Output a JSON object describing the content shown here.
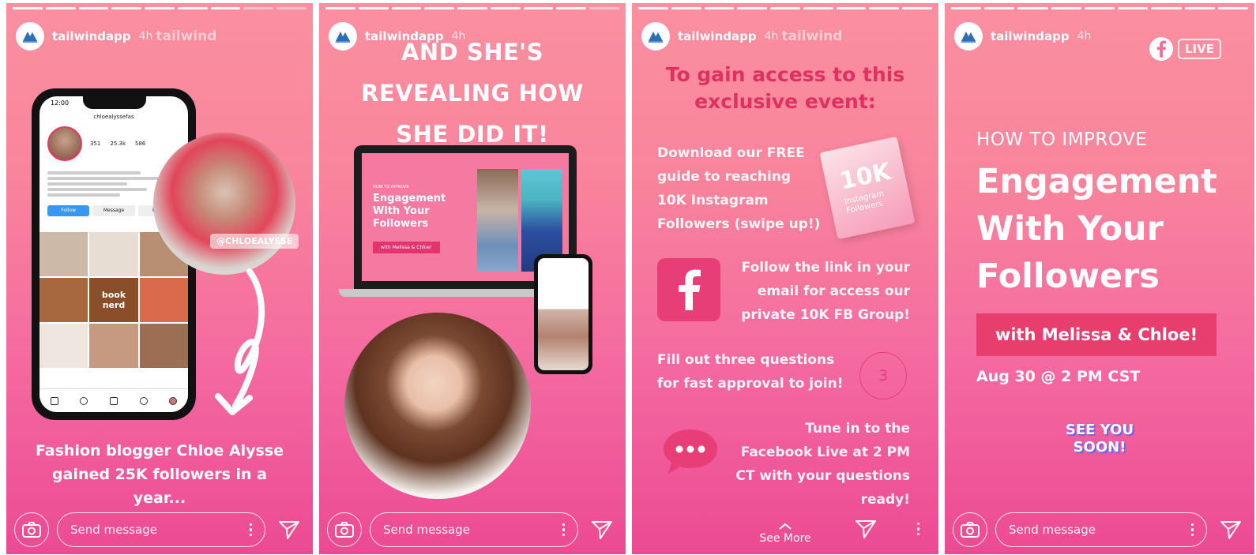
{
  "stories": [
    {
      "user": "tailwindapp",
      "time": "4h",
      "watermark": "tailwind",
      "caption": "Fashion blogger Chloe Alysse gained 25K followers in a year...",
      "sticker_tag": "@CHLOEALYSSE",
      "phone": {
        "status_time": "12:00",
        "handle": "chloealyssefas",
        "stats": [
          "351",
          "25.3k",
          "586"
        ],
        "buttons": [
          "Follow",
          "Message",
          "Email"
        ],
        "grid_label": "book nerd"
      },
      "message_placeholder": "Send message"
    },
    {
      "user": "tailwindapp",
      "time": "4h",
      "title": "AND SHE'S REVEALING HOW SHE DID IT!",
      "laptop": {
        "kicker": "HOW TO IMPROVE",
        "title": "Engagement With Your Followers",
        "pill": "with Melissa & Chloe!"
      },
      "message_placeholder": "Send message"
    },
    {
      "user": "tailwindapp",
      "time": "4h",
      "watermark": "tailwind",
      "title": "To gain access to this exclusive event:",
      "step1": "Download our FREE guide to reaching 10K Instagram Followers (swipe up!)",
      "ebook": {
        "big": "10K",
        "sub": "Instagram Followers"
      },
      "step2": "Follow the link in your email for access our private 10K FB Group!",
      "step3": "Fill out three questions for fast approval to join!",
      "step3_number": "3",
      "step4": "Tune in to the Facebook Live at 2 PM CT with your questions ready!",
      "see_more": "See More"
    },
    {
      "user": "tailwindapp",
      "time": "4h",
      "live_label": "LIVE",
      "kicker": "HOW TO IMPROVE",
      "title": "Engagement With Your Followers",
      "pill": "with Melissa & Chloe!",
      "date": "Aug 30 @ 2 PM CST",
      "sticker": "SEE YOU SOON!",
      "message_placeholder": "Send message"
    }
  ],
  "colors": {
    "gradient_top": "#fb8fa0",
    "gradient_bottom": "#ec4a93",
    "accent": "#e83e78",
    "title_pink": "#e0305f"
  }
}
